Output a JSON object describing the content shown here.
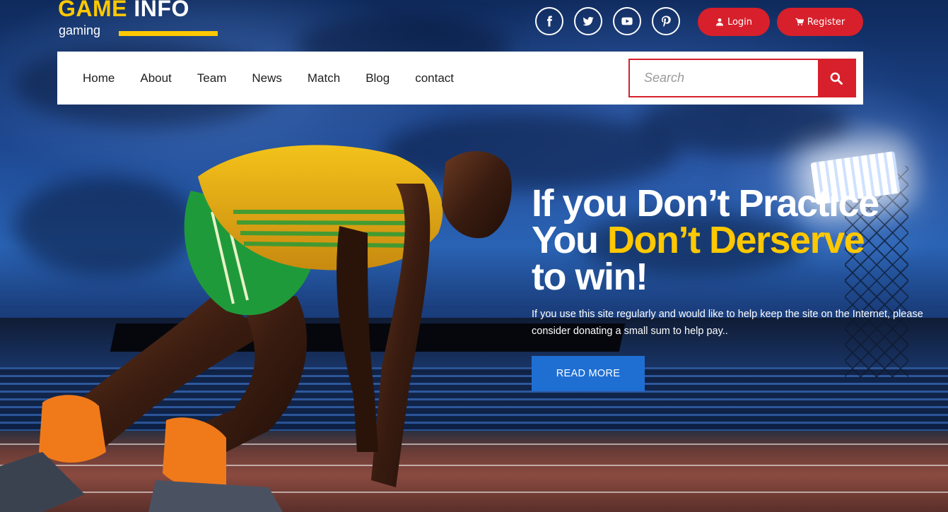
{
  "brand": {
    "title_part1": "GAME",
    "title_part2": "INFO",
    "subtitle": "gaming",
    "accent_color": "#ffc800"
  },
  "header": {
    "socials": [
      {
        "name": "facebook",
        "icon": "facebook-icon"
      },
      {
        "name": "twitter",
        "icon": "twitter-icon"
      },
      {
        "name": "youtube",
        "icon": "youtube-icon"
      },
      {
        "name": "pinterest",
        "icon": "pinterest-icon"
      }
    ],
    "login_label": "Login",
    "login_icon": "user-icon",
    "register_label": "Register",
    "register_icon": "cart-icon",
    "button_color": "#d7202b"
  },
  "nav": {
    "items": [
      {
        "label": "Home"
      },
      {
        "label": "About"
      },
      {
        "label": "Team"
      },
      {
        "label": "News"
      },
      {
        "label": "Match"
      },
      {
        "label": "Blog"
      },
      {
        "label": "contact"
      }
    ],
    "search_placeholder": "Search",
    "search_icon": "search-icon"
  },
  "hero": {
    "title_line1": "If you Don’t Practice",
    "title_line2_white": "You",
    "title_line2_highlight": "Don’t Derserve",
    "title_line3": "to win!",
    "description": "If you use this site regularly and would like to help keep the site on the Internet, please consider donating a small sum to help pay..",
    "button_label": "READ MORE",
    "button_color": "#1f6fd3"
  }
}
